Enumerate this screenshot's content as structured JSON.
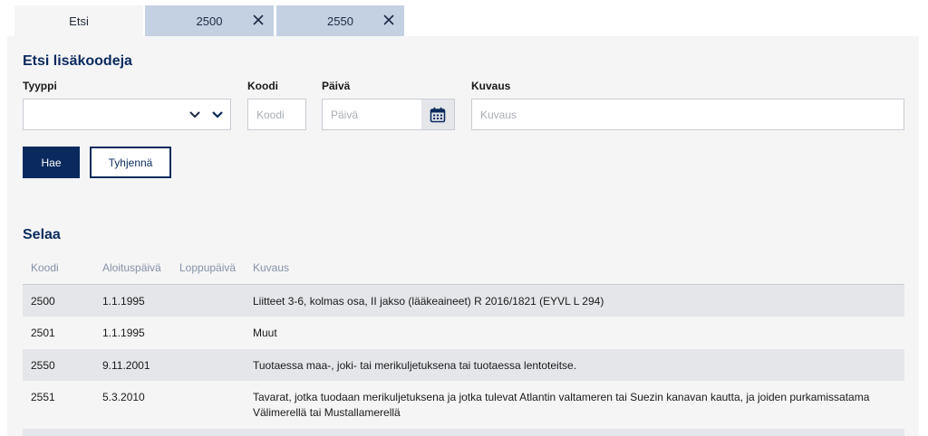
{
  "tabs": [
    {
      "label": "Etsi",
      "active": true
    },
    {
      "label": "2500",
      "closable": true
    },
    {
      "label": "2550",
      "closable": true
    }
  ],
  "search": {
    "title": "Etsi lisäkoodeja",
    "type_label": "Tyyppi",
    "type_value": "",
    "code_label": "Koodi",
    "code_placeholder": "Koodi",
    "date_label": "Päivä",
    "date_placeholder": "Päivä",
    "desc_label": "Kuvaus",
    "desc_placeholder": "Kuvaus",
    "search_button": "Hae",
    "clear_button": "Tyhjennä"
  },
  "browse": {
    "title": "Selaa",
    "columns": [
      "Koodi",
      "Aloituspäivä",
      "Loppupäivä",
      "Kuvaus"
    ],
    "rows": [
      {
        "code": "2500",
        "start": "1.1.1995",
        "end": "",
        "desc": "Liitteet 3-6, kolmas osa, II jakso (lääkeaineet) R 2016/1821 (EYVL L 294)"
      },
      {
        "code": "2501",
        "start": "1.1.1995",
        "end": "",
        "desc": "Muut"
      },
      {
        "code": "2550",
        "start": "9.11.2001",
        "end": "",
        "desc": "Tuotaessa maa-, joki- tai merikuljetuksena tai tuotaessa lentoteitse."
      },
      {
        "code": "2551",
        "start": "5.3.2010",
        "end": "",
        "desc": "Tavarat, jotka tuodaan merikuljetuksena ja jotka tulevat Atlantin valtameren tai Suezin kanavan kautta, ja joiden purkamissatama Välimerellä tai Mustallamerellä"
      }
    ]
  },
  "colors": {
    "primary": "#0a2a5e",
    "tab_inactive": "#c4d1e3",
    "panel": "#f5f5f6",
    "row_alt": "#e4e6ea",
    "header_text": "#8592a6"
  },
  "icons": {
    "close": "close-icon",
    "chevron": "chevron-down-icon",
    "calendar": "calendar-icon"
  }
}
